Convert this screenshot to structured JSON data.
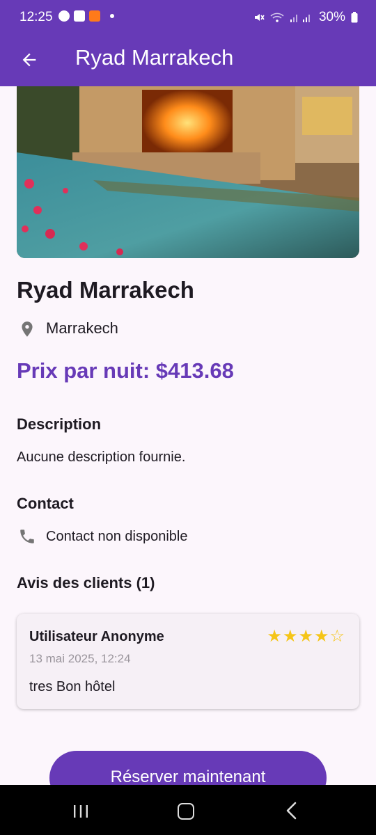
{
  "status_bar": {
    "time": "12:25",
    "battery": "30%",
    "icons": [
      "facebook-icon",
      "gallery-icon",
      "app-notification-icon",
      "mute-icon",
      "wifi-icon",
      "signal-icon",
      "battery-icon"
    ]
  },
  "app_bar": {
    "title": "Ryad Marrakech",
    "back_icon": "arrow-left-icon"
  },
  "hotel": {
    "name": "Ryad Marrakech",
    "location": "Marrakech",
    "price": "Prix par nuit: $413.68"
  },
  "description": {
    "heading": "Description",
    "text": "Aucune description fournie."
  },
  "contact": {
    "heading": "Contact",
    "text": "Contact non disponible"
  },
  "reviews": {
    "heading": "Avis des clients (1)",
    "items": [
      {
        "user": "Utilisateur Anonyme",
        "date": "13 mai 2025, 12:24",
        "rating": 4,
        "max_rating": 5,
        "stars": "★★★★☆",
        "text": "tres Bon hôtel"
      }
    ]
  },
  "book_button": "Réserver maintenant",
  "colors": {
    "primary": "#673ab7",
    "background": "#fcf6fc",
    "star": "#f5c518",
    "card": "#f6f0f6"
  }
}
